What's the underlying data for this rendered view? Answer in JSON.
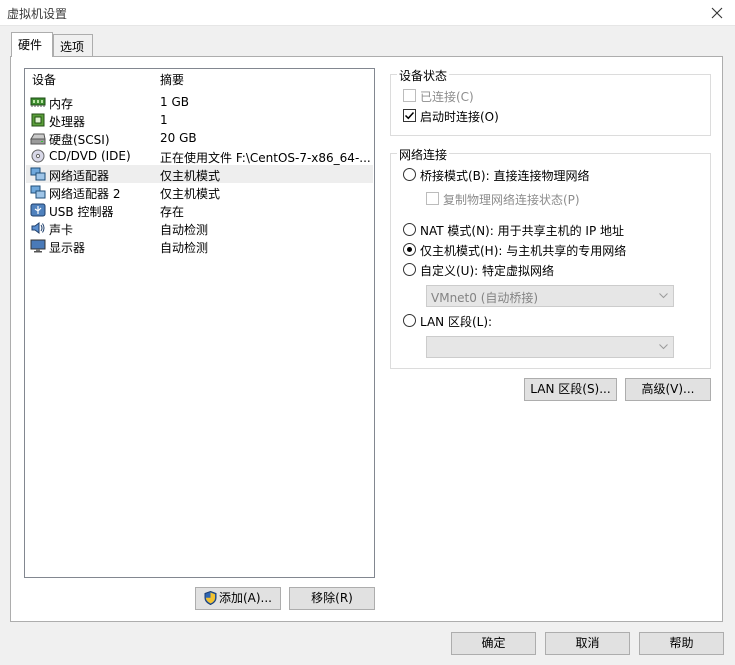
{
  "window": {
    "title": "虚拟机设置"
  },
  "tabs": [
    {
      "label": "硬件"
    },
    {
      "label": "选项"
    }
  ],
  "device_list": {
    "headers": {
      "device": "设备",
      "summary": "摘要"
    },
    "items": [
      {
        "name": "内存",
        "summary": "1 GB",
        "icon": "memory-icon"
      },
      {
        "name": "处理器",
        "summary": "1",
        "icon": "processor-icon"
      },
      {
        "name": "硬盘(SCSI)",
        "summary": "20 GB",
        "icon": "hard-disk-icon"
      },
      {
        "name": "CD/DVD (IDE)",
        "summary": "正在使用文件 F:\\CentOS-7-x86_64-...",
        "icon": "cd-dvd-icon"
      },
      {
        "name": "网络适配器",
        "summary": "仅主机模式",
        "icon": "network-adapter-icon",
        "selected": true
      },
      {
        "name": "网络适配器 2",
        "summary": "仅主机模式",
        "icon": "network-adapter-icon"
      },
      {
        "name": "USB 控制器",
        "summary": "存在",
        "icon": "usb-icon"
      },
      {
        "name": "声卡",
        "summary": "自动检测",
        "icon": "sound-card-icon"
      },
      {
        "name": "显示器",
        "summary": "自动检测",
        "icon": "display-icon"
      }
    ],
    "add_label": "添加(A)...",
    "remove_label": "移除(R)"
  },
  "device_status": {
    "title": "设备状态",
    "connected": {
      "label": "已连接(C)",
      "checked": false,
      "disabled": true
    },
    "connect_on_start": {
      "label": "启动时连接(O)",
      "checked": true
    }
  },
  "network": {
    "title": "网络连接",
    "bridged": {
      "label": "桥接模式(B): 直接连接物理网络",
      "selected": false
    },
    "replicate": {
      "label": "复制物理网络连接状态(P)",
      "checked": false,
      "disabled": true
    },
    "nat": {
      "label": "NAT 模式(N): 用于共享主机的 IP 地址",
      "selected": false
    },
    "host_only": {
      "label": "仅主机模式(H): 与主机共享的专用网络",
      "selected": true
    },
    "custom": {
      "label": "自定义(U): 特定虚拟网络",
      "selected": false
    },
    "custom_value": "VMnet0 (自动桥接)",
    "lan_segment": {
      "label": "LAN 区段(L):",
      "selected": false
    },
    "lan_value": "",
    "lan_button": "LAN 区段(S)...",
    "advanced_button": "高级(V)..."
  },
  "footer": {
    "ok": "确定",
    "cancel": "取消",
    "help": "帮助"
  }
}
